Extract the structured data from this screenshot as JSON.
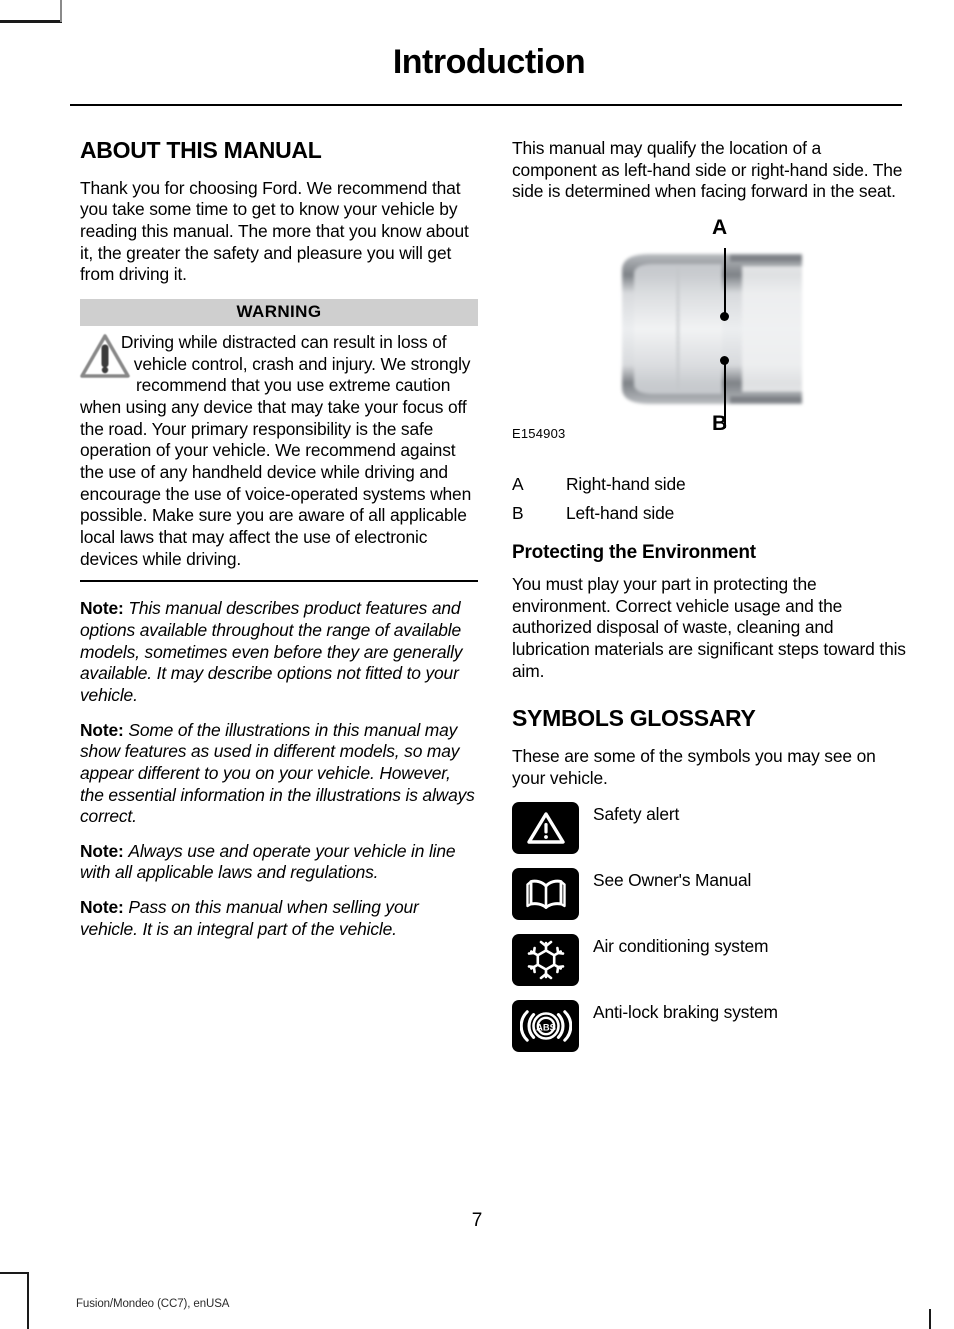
{
  "page": {
    "title": "Introduction",
    "number": "7",
    "footer": "Fusion/Mondeo (CC7), enUSA"
  },
  "left_column": {
    "section_heading": "ABOUT THIS MANUAL",
    "intro_paragraph": "Thank you for choosing Ford. We recommend that you take some time to get to know your vehicle by reading this manual. The more that you know about it, the greater the safety and pleasure you will get from driving it.",
    "warning": {
      "bar_label": "WARNING",
      "icon": "warning-triangle-icon",
      "text": "Driving while distracted can result in loss of vehicle control, crash and injury. We strongly recommend that you use extreme caution when using any device that may take your focus off the road. Your primary responsibility is the safe operation of your vehicle. We recommend against the use of any handheld device while driving and encourage the use of voice-operated systems when possible. Make sure you are aware of all applicable local laws that may affect the use of electronic devices while driving."
    },
    "notes": [
      {
        "label": "Note:",
        "text": "This manual describes product features and options available throughout the range of available models, sometimes even before they are generally available. It may describe options not fitted to your vehicle."
      },
      {
        "label": "Note:",
        "text": "Some of the illustrations in this manual may show features as used in different models, so may appear different to you on your vehicle. However, the essential information in the illustrations is always correct."
      },
      {
        "label": "Note:",
        "text": "Always use and operate your vehicle in line with all applicable laws and regulations."
      },
      {
        "label": "Note:",
        "text": "Pass on this manual when selling your vehicle. It is an integral part of the vehicle."
      }
    ]
  },
  "right_column": {
    "orientation_paragraph": "This manual may qualify the location of a component as left-hand side or right-hand side. The side is determined when facing forward in the seat.",
    "figure": {
      "code": "E154903",
      "callout_a": "A",
      "callout_b": "B",
      "image": "vehicle-top-view"
    },
    "legend": [
      {
        "key": "A",
        "value": "Right-hand side"
      },
      {
        "key": "B",
        "value": "Left-hand side"
      }
    ],
    "environment": {
      "heading": "Protecting the Environment",
      "text": "You must play your part in protecting the environment. Correct vehicle usage and the authorized disposal of waste, cleaning and lubrication materials are significant steps toward this aim."
    },
    "symbols_glossary": {
      "heading": "SYMBOLS GLOSSARY",
      "intro": "These are some of the symbols you may see on your vehicle.",
      "items": [
        {
          "icon": "safety-alert-icon",
          "label": "Safety alert"
        },
        {
          "icon": "owners-manual-book-icon",
          "label": "See Owner's Manual"
        },
        {
          "icon": "snowflake-air-conditioning-icon",
          "label": "Air conditioning system"
        },
        {
          "icon": "abs-brake-icon",
          "label": "Anti-lock braking system"
        }
      ]
    }
  },
  "colors": {
    "warning_bar_bg": "#cfcfcf",
    "symbol_box_bg": "#000000",
    "text": "#000000",
    "page_bg": "#ffffff"
  }
}
